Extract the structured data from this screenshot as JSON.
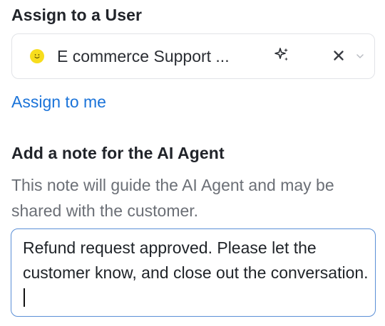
{
  "assign": {
    "title": "Assign to a User",
    "selected_value": "E commerce Support ...",
    "assign_to_me_label": "Assign to me"
  },
  "note": {
    "title": "Add a note for the AI Agent",
    "helper_text": "This note will guide the AI Agent and may be shared with the customer.",
    "value": "Refund request approved. Please let the customer know, and close out the conversation."
  },
  "colors": {
    "link": "#1a73d9",
    "focus_border": "#5b8fd6",
    "avatar": "#f7dd1d"
  },
  "icons": {
    "avatar": "smiley-icon",
    "ai": "sparkle-icon",
    "clear": "close-icon",
    "dropdown": "chevron-down-icon"
  }
}
